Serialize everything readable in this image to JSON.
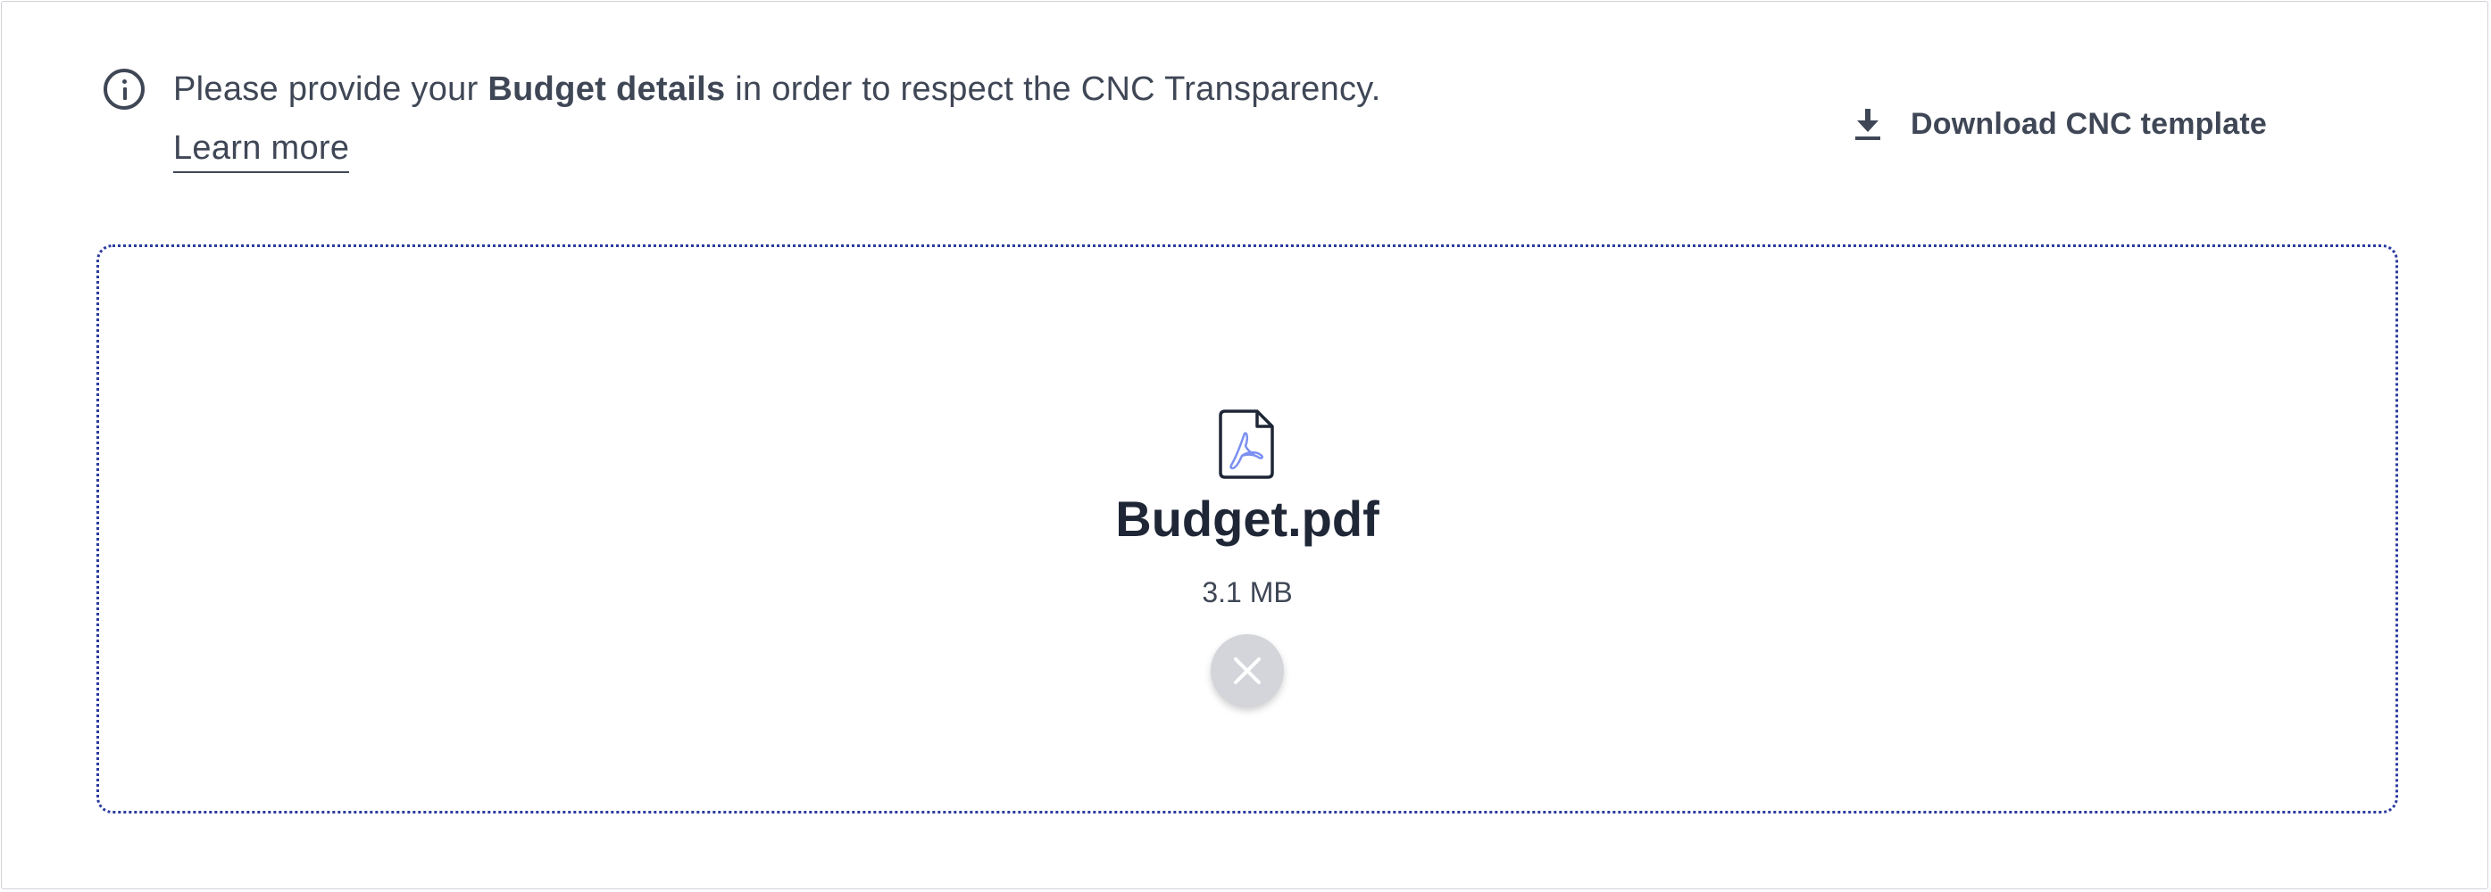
{
  "notice": {
    "text_before": "Please provide your ",
    "text_bold": "Budget details",
    "text_after": " in order to respect the CNC Transparency.",
    "learn_more_label": "Learn more",
    "icon": "info-icon"
  },
  "download": {
    "label": "Download CNC template",
    "icon": "download-icon"
  },
  "upload": {
    "file_name": "Budget.pdf",
    "file_size": "3.1 MB",
    "file_icon": "pdf-file-icon",
    "remove_icon": "close-icon"
  },
  "colors": {
    "text": "#3f4756",
    "heading": "#1f2737",
    "dropzone_border": "#2b3b9e",
    "pdf_accent": "#7b8ff0",
    "remove_button_bg": "#d3d5da"
  }
}
